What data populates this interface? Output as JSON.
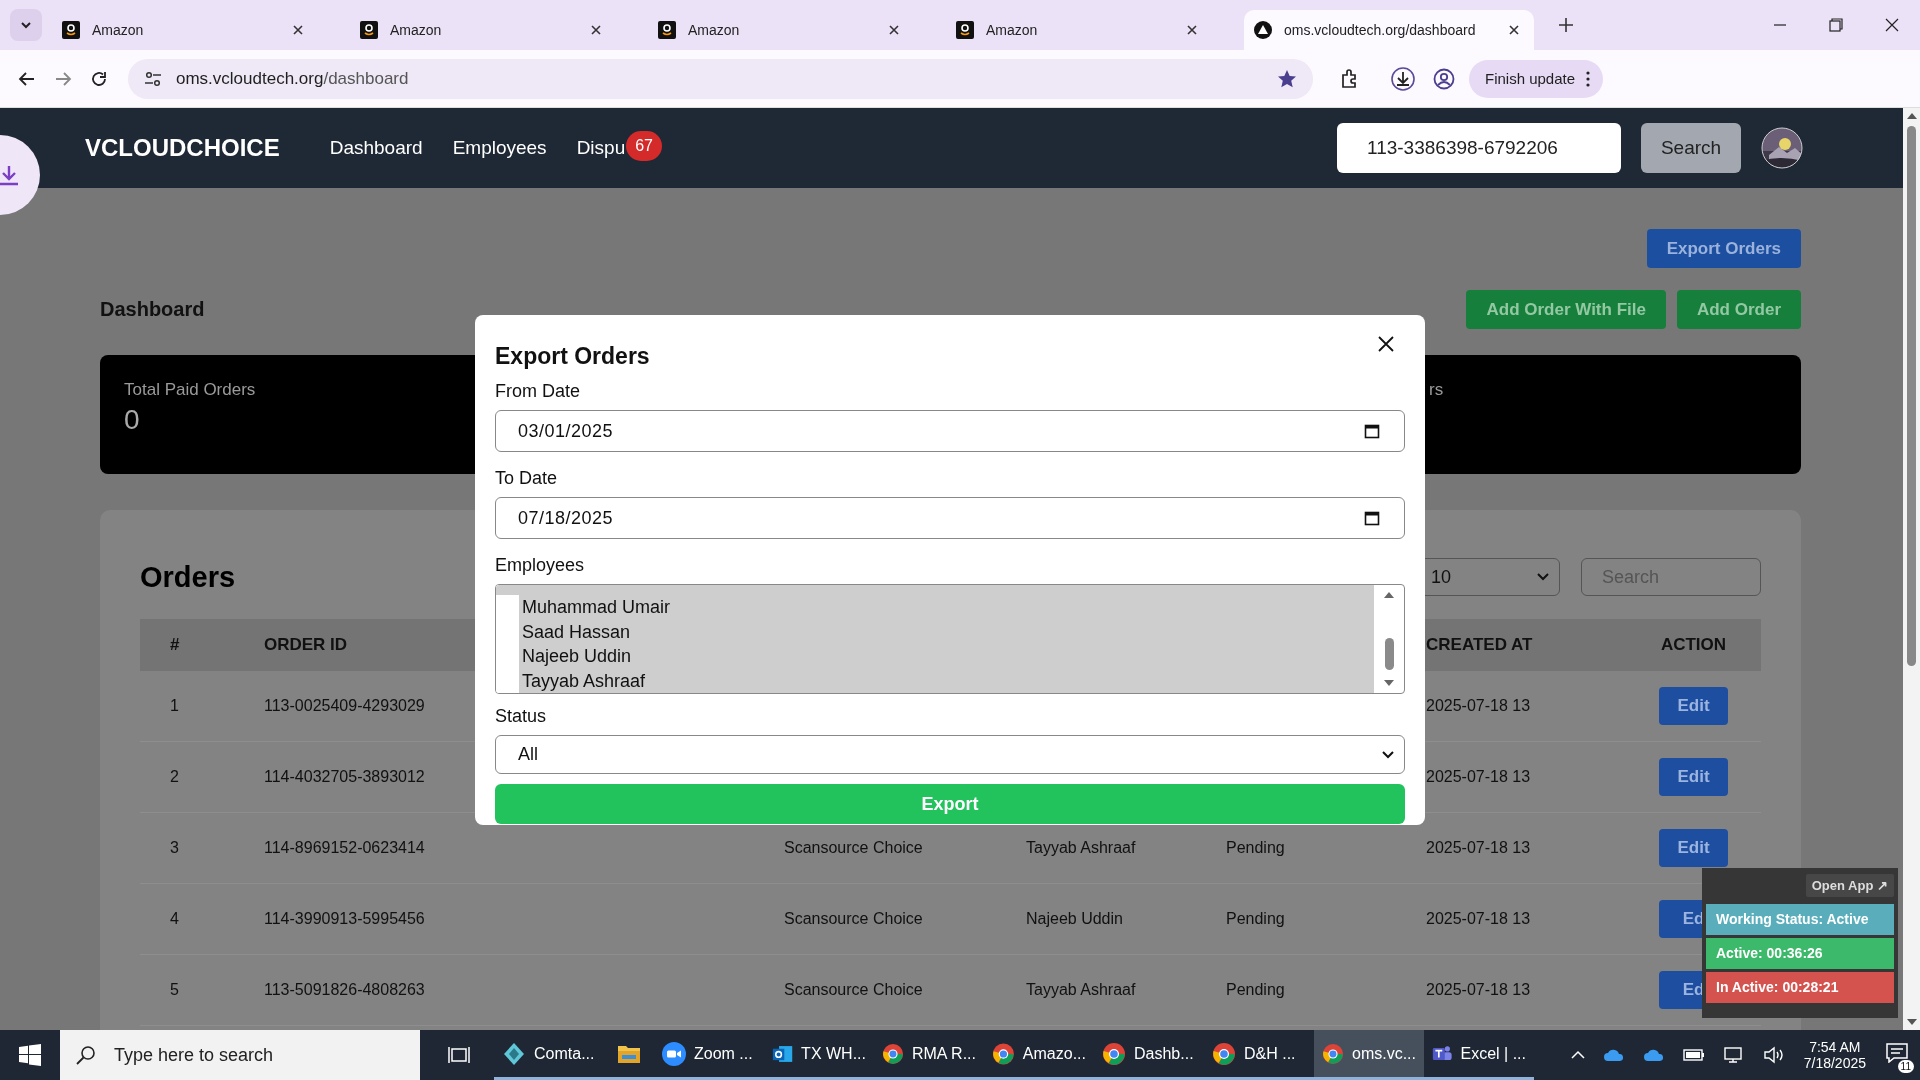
{
  "browser": {
    "tabs": [
      {
        "kind": "shop",
        "title": "Amazon",
        "selected": false
      },
      {
        "kind": "shop",
        "title": "Amazon",
        "selected": false
      },
      {
        "kind": "shop",
        "title": "Amazon",
        "selected": false
      },
      {
        "kind": "shop",
        "title": "Amazon",
        "selected": false
      },
      {
        "kind": "site",
        "title": "oms.vcloudtech.org/dashboard",
        "selected": true
      }
    ],
    "url": {
      "host": "oms.vcloudtech.org",
      "path": "/dashboard"
    },
    "finish_update": "Finish update"
  },
  "navbar": {
    "logo": "VCLOUDCHOICE",
    "links": [
      "Dashboard",
      "Employees",
      "Dispu"
    ],
    "badge": "67",
    "search_value": "113-3386398-6792206",
    "search_button": "Search"
  },
  "page": {
    "title": "Dashboard",
    "export_button": "Export Orders",
    "add_file_button": "Add Order With File",
    "add_button": "Add Order",
    "stats": [
      {
        "label": "Total Paid Orders",
        "value": "0"
      },
      {
        "label": "rs"
      }
    ]
  },
  "orders": {
    "title": "Orders",
    "page_size": "10",
    "search_placeholder": "Search",
    "header": {
      "num": "#",
      "order_id": "ORDER ID",
      "created_at": "CREATED AT",
      "action": "ACTION"
    },
    "rows": [
      {
        "num": "1",
        "order_id": "113-0025409-4293029",
        "created_at": "2025-07-18 13",
        "action": "Edit"
      },
      {
        "num": "2",
        "order_id": "114-4032705-3893012",
        "created_at": "2025-07-18 13",
        "action": "Edit"
      },
      {
        "num": "3",
        "order_id": "114-8969152-0623414",
        "store": "Scansource Choice",
        "employee": "Tayyab Ashraaf",
        "status": "Pending",
        "created_at": "2025-07-18 13",
        "action": "Edit"
      },
      {
        "num": "4",
        "order_id": "114-3990913-5995456",
        "store": "Scansource Choice",
        "employee": "Najeeb Uddin",
        "status": "Pending",
        "created_at": "2025-07-18 13",
        "action": "Ed"
      },
      {
        "num": "5",
        "order_id": "113-5091826-4808263",
        "store": "Scansource Choice",
        "employee": "Tayyab Ashraaf",
        "status": "Pending",
        "created_at": "2025-07-18 13",
        "action": "Ed"
      }
    ]
  },
  "modal": {
    "title": "Export Orders",
    "from_label": "From Date",
    "from_value": "03/01/2025",
    "to_label": "To Date",
    "to_value": "07/18/2025",
    "employees_label": "Employees",
    "employees": [
      {
        "name": "Muhammad Umair",
        "selected": true
      },
      {
        "name": "Saad Hassan",
        "selected": true
      },
      {
        "name": "Najeeb Uddin",
        "selected": true
      },
      {
        "name": "Tayyab Ashraaf",
        "selected": true
      }
    ],
    "status_label": "Status",
    "status_value": "All",
    "export_button": "Export"
  },
  "widget": {
    "open_app": "Open App ↗",
    "items": [
      {
        "text": "Working Status: Active",
        "color": "#5aaebb"
      },
      {
        "text": "Active: 00:36:26",
        "color": "#3cb96a"
      },
      {
        "text": "In Active: 00:28:21",
        "color": "#d5534e"
      }
    ]
  },
  "taskbar": {
    "search_placeholder": "Type here to search",
    "apps": [
      {
        "kind": "diamond",
        "label": "Comta...",
        "selected": false
      },
      {
        "kind": "folder",
        "selected": false
      },
      {
        "kind": "zoom",
        "label": "Zoom ...",
        "selected": false
      },
      {
        "kind": "mail",
        "label": "TX WH...",
        "selected": false
      },
      {
        "kind": "browser",
        "label": "RMA R...",
        "selected": false
      },
      {
        "kind": "browser",
        "label": "Amazo...",
        "selected": false
      },
      {
        "kind": "browser",
        "label": "Dashb...",
        "selected": false
      },
      {
        "kind": "browser",
        "label": "D&H ...",
        "selected": false
      },
      {
        "kind": "browser",
        "label": "oms.vc...",
        "selected": true
      },
      {
        "kind": "team",
        "label": "Excel | ...",
        "selected": false
      }
    ],
    "time": "7:54 AM",
    "date": "7/18/2025",
    "notifications": "11"
  }
}
